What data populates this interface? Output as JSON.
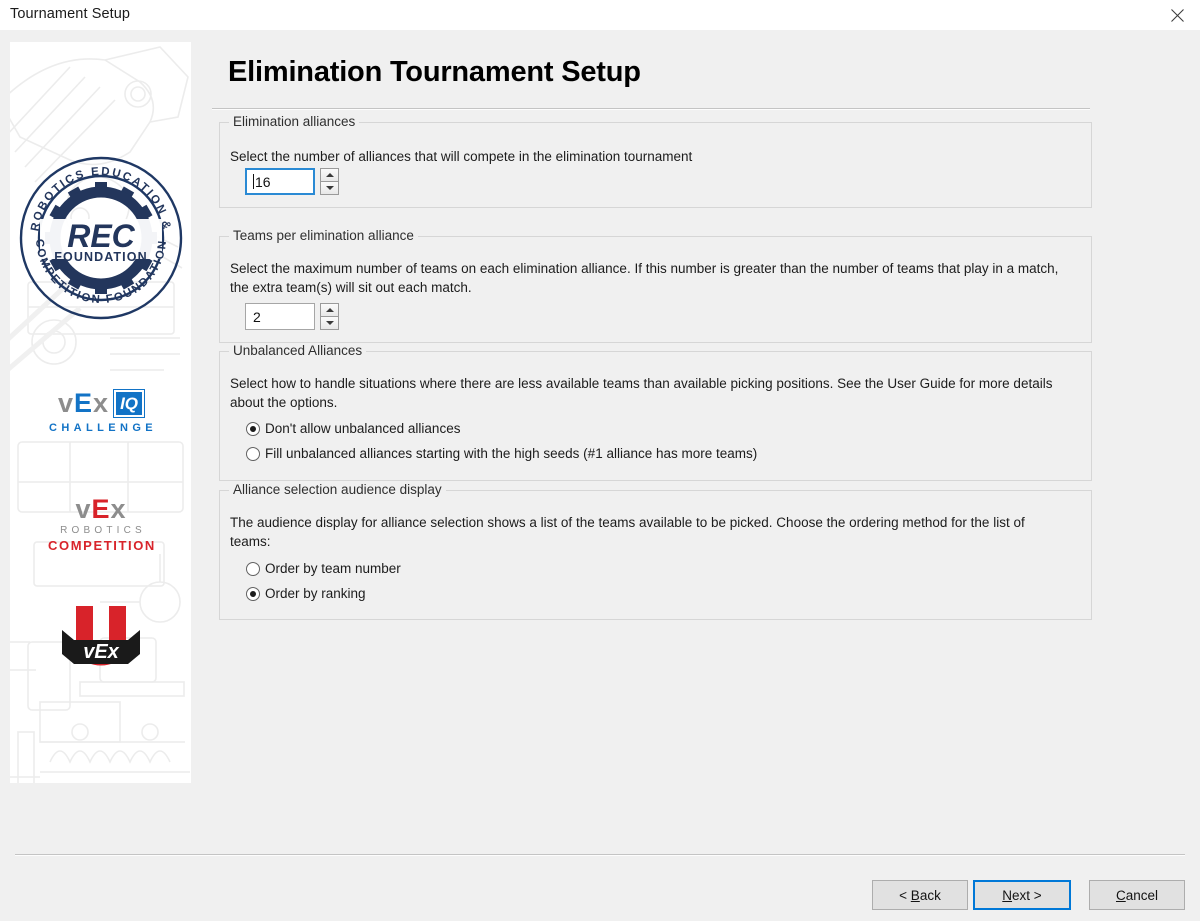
{
  "window": {
    "title": "Tournament Setup",
    "close_icon": "close-icon"
  },
  "page": {
    "heading": "Elimination Tournament Setup"
  },
  "sidebar": {
    "logos": [
      {
        "name": "rec-foundation-logo",
        "outer_top_text": "ROBOTICS EDUCATION &",
        "outer_bottom_text": "COMPETITION FOUNDATION",
        "center_text": "REC",
        "center_subtext": "FOUNDATION",
        "color": "#1f3864"
      },
      {
        "name": "vex-iq-challenge-logo",
        "v": "v",
        "e": "E",
        "x": "x",
        "badge": "IQ",
        "subtext": "CHALLENGE",
        "gray": "#8d8d8d",
        "blue": "#1273c6"
      },
      {
        "name": "vex-robotics-competition-logo",
        "v": "v",
        "e": "E",
        "x": "x",
        "line2": "ROBOTICS",
        "line3": "COMPETITION",
        "gray": "#8d8d8d",
        "red": "#d8232a"
      },
      {
        "name": "vex-u-logo",
        "letter": "U",
        "banner_text": "VEX",
        "red": "#d8232a",
        "black": "#1a1a1a"
      }
    ]
  },
  "groups": {
    "elimination_alliances": {
      "title": "Elimination alliances",
      "description": "Select the number of alliances that will compete in the elimination tournament",
      "spinner": {
        "value": "16",
        "focused": true,
        "up_icon": "spinner-up-arrow-icon",
        "down_icon": "spinner-down-arrow-icon"
      }
    },
    "teams_per_alliance": {
      "title": "Teams per elimination alliance",
      "description": "Select the maximum number of teams on each elimination alliance.  If this number is greater than the number of teams that play in a match, the extra team(s) will sit out each match.",
      "spinner": {
        "value": "2",
        "focused": false,
        "up_icon": "spinner-up-arrow-icon",
        "down_icon": "spinner-down-arrow-icon"
      }
    },
    "unbalanced_alliances": {
      "title": "Unbalanced Alliances",
      "description": "Select how to handle situations where there are less available teams than available picking positions.  See the User Guide for more details about the options.",
      "options": [
        {
          "label": "Don't allow unbalanced alliances",
          "selected": true
        },
        {
          "label": "Fill unbalanced alliances starting with the high seeds (#1 alliance has more teams)",
          "selected": false
        }
      ]
    },
    "audience_display": {
      "title": "Alliance selection audience display",
      "description": "The audience display for alliance selection shows a list of the teams available to be picked.  Choose the ordering method for the list of teams:",
      "options": [
        {
          "label": "Order by team number",
          "selected": false
        },
        {
          "label": "Order by ranking",
          "selected": true
        }
      ]
    }
  },
  "footer": {
    "back": {
      "pre": "< ",
      "mnemonic": "B",
      "post": "ack"
    },
    "next": {
      "pre": "",
      "mnemonic": "N",
      "post": "ext >"
    },
    "cancel": {
      "pre": "",
      "mnemonic": "C",
      "post": "ancel"
    }
  }
}
